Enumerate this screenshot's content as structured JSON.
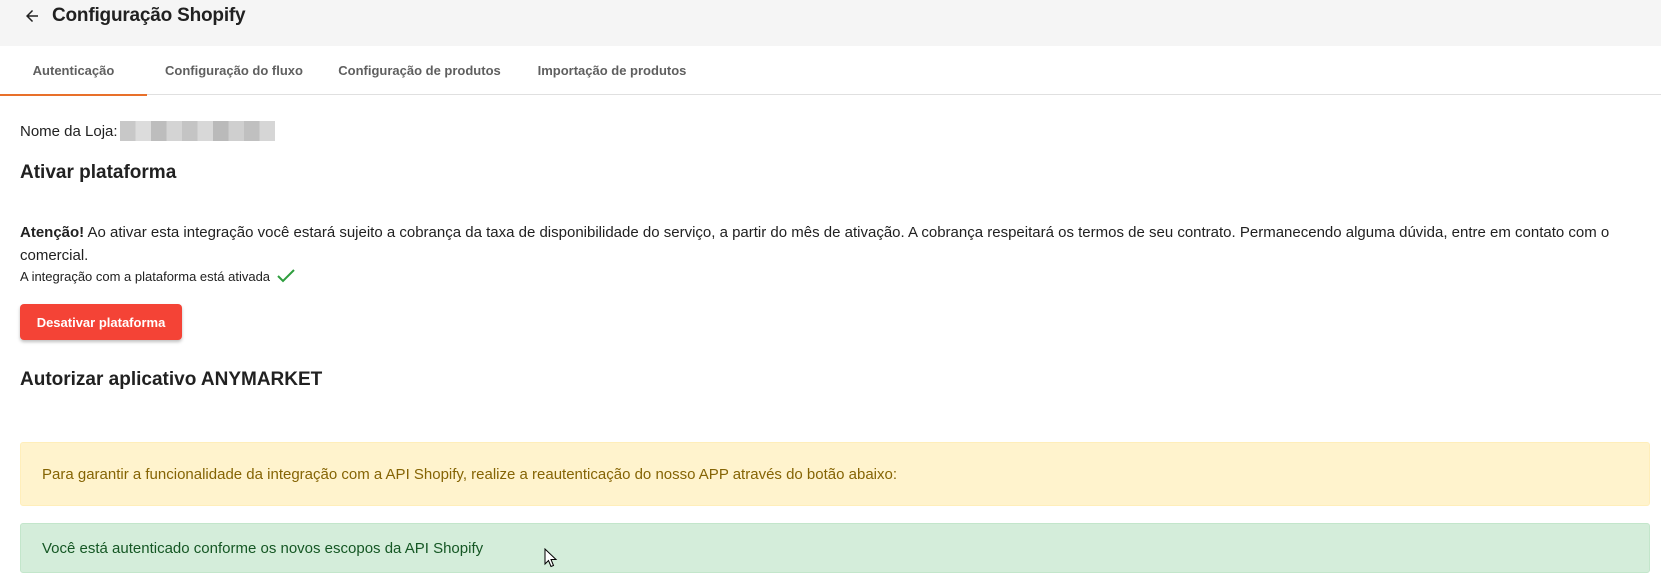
{
  "header": {
    "title": "Configuração Shopify",
    "back_icon": "arrow-left-icon"
  },
  "tabs": [
    {
      "label": "Autenticação",
      "active": true
    },
    {
      "label": "Configuração do fluxo",
      "active": false
    },
    {
      "label": "Configuração de produtos",
      "active": false
    },
    {
      "label": "Importação de produtos",
      "active": false
    }
  ],
  "store": {
    "label": "Nome da Loja:"
  },
  "activate_section": {
    "title": "Ativar plataforma",
    "warning_bold": "Atenção!",
    "warning_text": " Ao ativar esta integração você estará sujeito a cobrança da taxa de disponibilidade do serviço, a partir do mês de ativação. A cobrança respeitará os termos de seu contrato. Permanecendo alguma dúvida, entre em contato com o comercial.",
    "status_text": "A integração com a plataforma está ativada",
    "status_icon": "checkmark-icon",
    "deactivate_label": "Desativar plataforma"
  },
  "authorize_section": {
    "title": "Autorizar aplicativo ANYMARKET",
    "warning_alert": "Para garantir a funcionalidade da integração com a API Shopify, realize a reautenticação do nosso APP através do botão abaixo:",
    "success_alert": "Você está autenticado conforme os novos escopos da API Shopify"
  },
  "colors": {
    "accent": "#e8702a",
    "danger": "#f44336",
    "check": "#2e9e3e"
  }
}
